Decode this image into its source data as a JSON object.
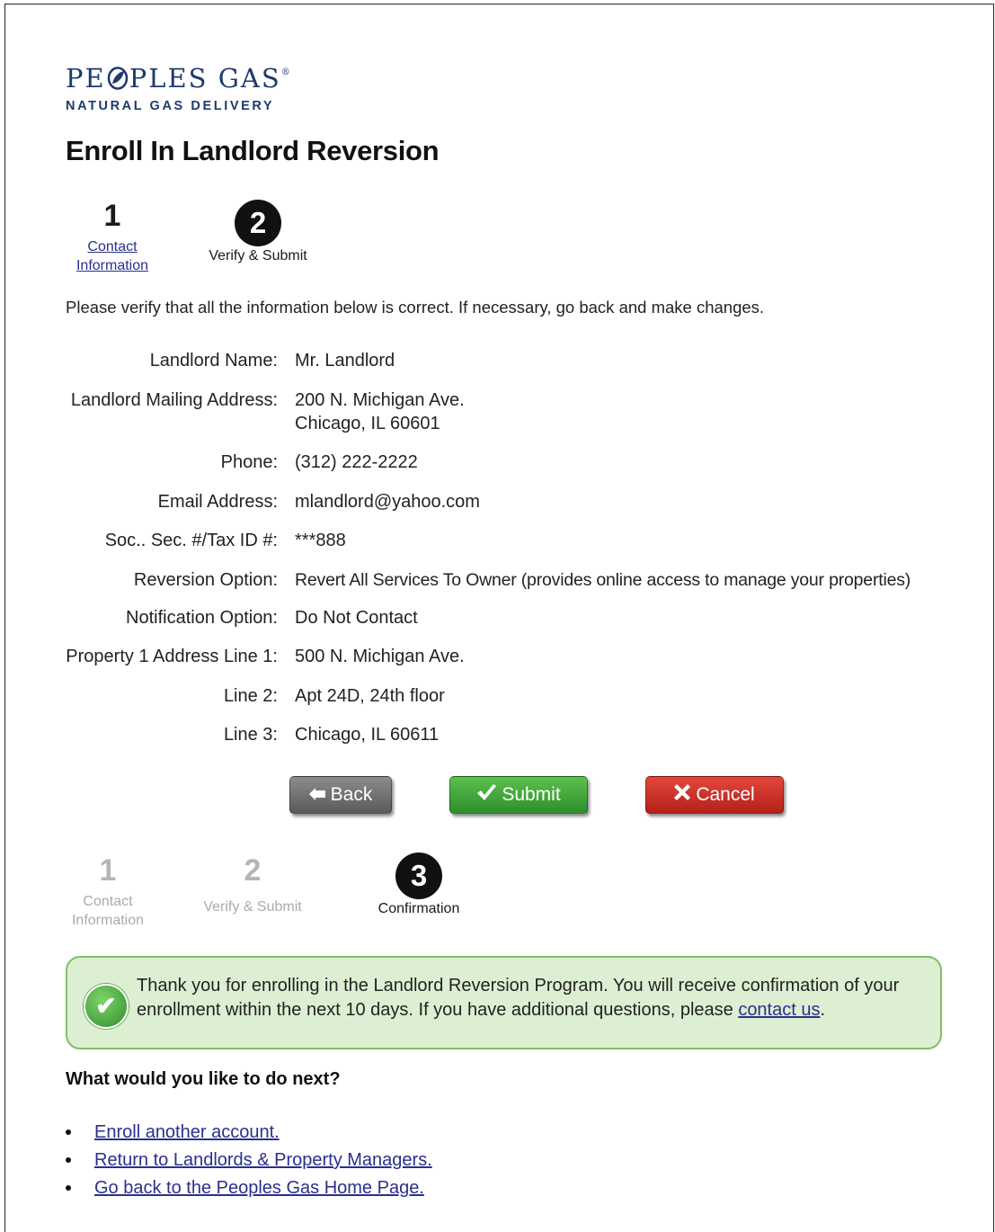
{
  "brand": {
    "logo_text_left": "PE",
    "logo_text_right": "PLES GAS",
    "logo_mark": "®",
    "tagline": "NATURAL GAS DELIVERY",
    "color": "#1e3a6e"
  },
  "page": {
    "title": "Enroll In Landlord Reversion"
  },
  "stepper_top": {
    "steps": [
      {
        "number": "1",
        "label_line1": "Contact",
        "label_line2": "Information",
        "state": "link"
      },
      {
        "number": "2",
        "label": "Verify & Submit",
        "state": "current"
      }
    ]
  },
  "instructions": "Please verify that all the information below is correct. If necessary, go back and make changes.",
  "fields": {
    "landlord_name": {
      "label": "Landlord Name:",
      "value": "Mr. Landlord"
    },
    "mailing_address": {
      "label": "Landlord Mailing Address:",
      "value_line1": "200 N. Michigan Ave.",
      "value_line2": "Chicago, IL 60601"
    },
    "phone": {
      "label": "Phone:",
      "value": "(312) 222-2222"
    },
    "email": {
      "label": "Email Address:",
      "value": "mlandlord@yahoo.com"
    },
    "ssn": {
      "label": "Soc.. Sec. #/Tax ID #:",
      "value": "***888"
    },
    "reversion": {
      "label": "Reversion Option:",
      "value": "Revert All Services To Owner (provides online access to manage your properties)"
    },
    "notification": {
      "label": "Notification Option:",
      "value": "Do Not Contact"
    },
    "prop_line1": {
      "label": "Property 1 Address Line 1:",
      "value": "500 N. Michigan Ave."
    },
    "prop_line2": {
      "label": "Line 2:",
      "value": "Apt 24D, 24th floor"
    },
    "prop_line3": {
      "label": "Line 3:",
      "value": "Chicago, IL 60611"
    }
  },
  "buttons": {
    "back": {
      "label": "Back",
      "icon": "left-arrow-icon",
      "color": "#6e6e6e"
    },
    "submit": {
      "label": "Submit",
      "icon": "check-icon",
      "color": "#3aa336"
    },
    "cancel": {
      "label": "Cancel",
      "icon": "x-icon",
      "color": "#cc2a22"
    }
  },
  "stepper_bottom": {
    "steps": [
      {
        "number": "1",
        "label_line1": "Contact",
        "label_line2": "Information",
        "state": "done"
      },
      {
        "number": "2",
        "label": "Verify & Submit",
        "state": "done"
      },
      {
        "number": "3",
        "label": "Confirmation",
        "state": "current"
      }
    ]
  },
  "confirmation": {
    "text_before_link": "Thank you for enrolling in the Landlord Reversion Program. You will receive confirmation of your enrollment within the next 10 days. If you have additional questions, please ",
    "link_text": "contact us",
    "text_after_link": ".",
    "bg_color": "#dcefd3",
    "border_color": "#7fbf65"
  },
  "next_steps": {
    "heading": "What would you like to do next?",
    "links": [
      "Enroll another account.",
      "Return to Landlords & Property Managers.",
      "Go back to the Peoples Gas Home Page."
    ]
  }
}
